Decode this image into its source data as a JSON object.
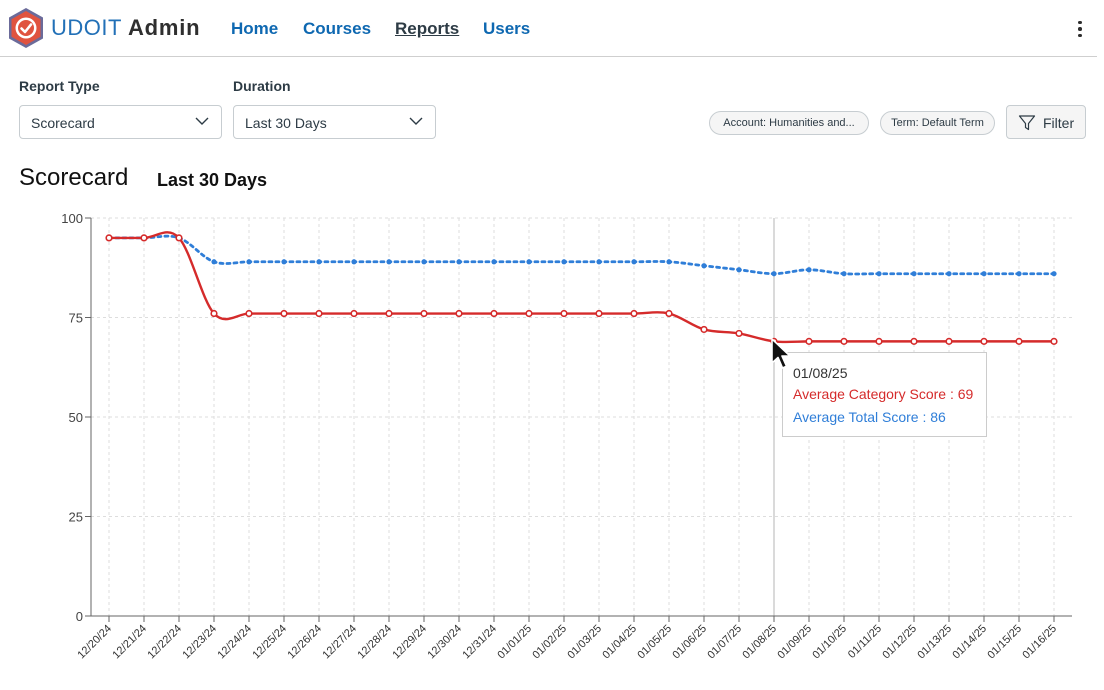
{
  "app": {
    "brand_name": "UDOIT",
    "brand_suffix": "Admin"
  },
  "nav": {
    "items": [
      {
        "label": "Home",
        "active": false
      },
      {
        "label": "Courses",
        "active": false
      },
      {
        "label": "Reports",
        "active": true
      },
      {
        "label": "Users",
        "active": false
      }
    ],
    "more_icon": "kebab-menu-icon"
  },
  "controls": {
    "report_type": {
      "label": "Report Type",
      "value": "Scorecard"
    },
    "duration": {
      "label": "Duration",
      "value": "Last 30 Days"
    },
    "pills": [
      "Account: Humanities and...",
      "Term: Default Term"
    ],
    "filter_label": "Filter"
  },
  "report": {
    "title": "Scorecard",
    "subtitle": "Last 30 Days"
  },
  "chart_data": {
    "type": "line",
    "categories": [
      "12/20/24",
      "12/21/24",
      "12/22/24",
      "12/23/24",
      "12/24/24",
      "12/25/24",
      "12/26/24",
      "12/27/24",
      "12/28/24",
      "12/29/24",
      "12/30/24",
      "12/31/24",
      "01/01/25",
      "01/02/25",
      "01/03/25",
      "01/04/25",
      "01/05/25",
      "01/06/25",
      "01/07/25",
      "01/08/25",
      "01/09/25",
      "01/10/25",
      "01/11/25",
      "01/12/25",
      "01/13/25",
      "01/14/25",
      "01/15/25",
      "01/16/25"
    ],
    "series": [
      {
        "key": "category",
        "color": "#d52b2b",
        "values": [
          95,
          95,
          95,
          76,
          76,
          76,
          76,
          76,
          76,
          76,
          76,
          76,
          76,
          76,
          76,
          76,
          76,
          72,
          71,
          69,
          69,
          69,
          69,
          69,
          69,
          69,
          69,
          69
        ]
      },
      {
        "key": "total",
        "color": "#2f7ed8",
        "values": [
          95,
          95,
          95,
          89,
          89,
          89,
          89,
          89,
          89,
          89,
          89,
          89,
          89,
          89,
          89,
          89,
          89,
          88,
          87,
          86,
          87,
          86,
          86,
          86,
          86,
          86,
          86,
          86
        ]
      }
    ],
    "y_ticks": [
      "0",
      "25",
      "50",
      "75",
      "100"
    ],
    "ylim": [
      0,
      100
    ],
    "grid": true
  },
  "tooltip": {
    "date": "01/08/25",
    "line1": "Average Category Score : 69",
    "line2": "Average Total Score : 86",
    "index": 19
  },
  "colors": {
    "brand_blue": "#2270b7",
    "link": "#0e68b1",
    "red": "#d52b2b",
    "blue": "#2f7ed8"
  }
}
